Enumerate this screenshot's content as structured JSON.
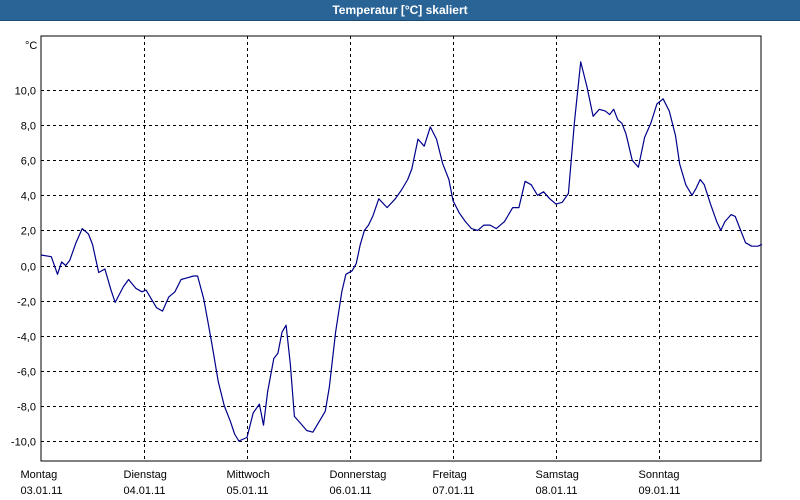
{
  "window": {
    "title": "Temperatur [°C] skaliert"
  },
  "colors": {
    "titlebar": "#2a6496",
    "line": "#00008b",
    "grid": "#000000",
    "background": "#ffffff"
  },
  "chart_data": {
    "type": "line",
    "title": "Temperatur [°C] skaliert",
    "ylabel": "°C",
    "xlabel": "",
    "ylim": [
      -11.0,
      13.0
    ],
    "xlim": [
      0,
      7
    ],
    "grid": true,
    "y_ticks": [
      10.0,
      8.0,
      6.0,
      4.0,
      2.0,
      0.0,
      -2.0,
      -4.0,
      -6.0,
      -8.0,
      -10.0
    ],
    "y_tick_labels": [
      "10,0",
      "8,0",
      "6,0",
      "4,0",
      "2,0",
      "0,0",
      "-2,0",
      "-4,0",
      "-6,0",
      "-8,0",
      "-10,0"
    ],
    "x_ticks": [
      0,
      1,
      2,
      3,
      4,
      5,
      6
    ],
    "x_tick_labels": [
      {
        "day": "Montag",
        "date": "03.01.11"
      },
      {
        "day": "Dienstag",
        "date": "04.01.11"
      },
      {
        "day": "Mittwoch",
        "date": "05.01.11"
      },
      {
        "day": "Donnerstag",
        "date": "06.01.11"
      },
      {
        "day": "Freitag",
        "date": "07.01.11"
      },
      {
        "day": "Samstag",
        "date": "08.01.11"
      },
      {
        "day": "Sonntag",
        "date": "09.01.11"
      }
    ],
    "series": [
      {
        "x": [
          0.0,
          0.1,
          0.16,
          0.2,
          0.24,
          0.28,
          0.34,
          0.4,
          0.46,
          0.5,
          0.56,
          0.62,
          0.68,
          0.72,
          0.8,
          0.85,
          0.92,
          0.98,
          1.02,
          1.06,
          1.12,
          1.18,
          1.24,
          1.3,
          1.36,
          1.42,
          1.48,
          1.52,
          1.58,
          1.62,
          1.66,
          1.72,
          1.78,
          1.84,
          1.88,
          1.92,
          2.0,
          2.06,
          2.12,
          2.16,
          2.2,
          2.26,
          2.3,
          2.34,
          2.38,
          2.42,
          2.46,
          2.52,
          2.58,
          2.64,
          2.68,
          2.72,
          2.76,
          2.8,
          2.86,
          2.92,
          2.96,
          3.02,
          3.06,
          3.1,
          3.14,
          3.18,
          3.22,
          3.28,
          3.36,
          3.44,
          3.5,
          3.56,
          3.6,
          3.66,
          3.72,
          3.78,
          3.84,
          3.9,
          3.96,
          4.0,
          4.06,
          4.12,
          4.18,
          4.24,
          4.3,
          4.36,
          4.42,
          4.5,
          4.58,
          4.64,
          4.7,
          4.76,
          4.82,
          4.88,
          4.94,
          5.0,
          5.06,
          5.12,
          5.18,
          5.24,
          5.3,
          5.36,
          5.42,
          5.48,
          5.52,
          5.56,
          5.6,
          5.64,
          5.68,
          5.74,
          5.8,
          5.86,
          5.92,
          5.98,
          6.04,
          6.1,
          6.16,
          6.2,
          6.26,
          6.32,
          6.36,
          6.4,
          6.44,
          6.5,
          6.56,
          6.6,
          6.64,
          6.7,
          6.74,
          6.78,
          6.84,
          6.9,
          6.96,
          7.0
        ],
        "values": [
          0.6,
          0.5,
          -0.5,
          0.2,
          0.0,
          0.3,
          1.3,
          2.1,
          1.8,
          1.2,
          -0.4,
          -0.2,
          -1.4,
          -2.1,
          -1.2,
          -0.8,
          -1.3,
          -1.5,
          -1.4,
          -1.8,
          -2.4,
          -2.6,
          -1.8,
          -1.5,
          -0.8,
          -0.7,
          -0.6,
          -0.6,
          -1.9,
          -3.2,
          -4.5,
          -6.6,
          -8.0,
          -8.9,
          -9.6,
          -10.0,
          -9.8,
          -8.4,
          -7.9,
          -9.1,
          -7.2,
          -5.3,
          -5.0,
          -3.8,
          -3.4,
          -5.6,
          -8.6,
          -9.0,
          -9.4,
          -9.5,
          -9.1,
          -8.7,
          -8.3,
          -6.9,
          -3.8,
          -1.5,
          -0.5,
          -0.3,
          0.1,
          1.2,
          2.0,
          2.3,
          2.8,
          3.8,
          3.3,
          3.8,
          4.3,
          4.9,
          5.5,
          7.2,
          6.8,
          7.9,
          7.2,
          5.8,
          4.9,
          3.7,
          3.0,
          2.5,
          2.1,
          2.0,
          2.3,
          2.3,
          2.1,
          2.5,
          3.3,
          3.3,
          4.8,
          4.6,
          4.0,
          4.2,
          3.8,
          3.5,
          3.6,
          4.1,
          8.2,
          11.6,
          10.2,
          8.5,
          8.9,
          8.8,
          8.6,
          8.9,
          8.3,
          8.1,
          7.5,
          6.0,
          5.6,
          7.3,
          8.1,
          9.2,
          9.5,
          8.8,
          7.4,
          5.8,
          4.6,
          4.0,
          4.4,
          4.9,
          4.6,
          3.5,
          2.5,
          2.0,
          2.5,
          2.9,
          2.8,
          2.2,
          1.3,
          1.1,
          1.1,
          1.2
        ]
      }
    ]
  }
}
